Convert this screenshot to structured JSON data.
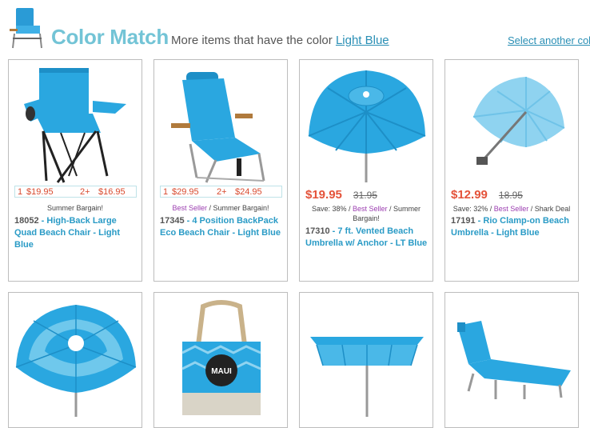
{
  "header": {
    "title": "Color Match",
    "subtitle_prefix": "More items that have the color",
    "color_link": "Light Blue",
    "select_another": "Select another colo"
  },
  "products": [
    {
      "tier_1_qty": "1",
      "tier_1_price": "$19.95",
      "tier_2_qty": "2+",
      "tier_2_price": "$16.95",
      "tagline": "Summer Bargain!",
      "sku": "18052",
      "name": "High-Back Large Quad Beach Chair - Light Blue",
      "icon": "beach-chair"
    },
    {
      "tier_1_qty": "1",
      "tier_1_price": "$29.95",
      "tier_2_qty": "2+",
      "tier_2_price": "$24.95",
      "badge": "Best Seller",
      "tagline_sep": " / ",
      "tagline": "Summer Bargain!",
      "sku": "17345",
      "name": "4 Position BackPack Eco Beach Chair - Light Blue",
      "icon": "backpack-beach-chair"
    },
    {
      "price": "$19.95",
      "old_price": "31.95",
      "save": "Save: 38% / ",
      "badge": "Best Seller",
      "tagline_sep": " / ",
      "tagline": "Summer Bargain!",
      "sku": "17310",
      "name": "7 ft. Vented Beach Umbrella w/ Anchor - LT Blue",
      "icon": "vented-umbrella"
    },
    {
      "price": "$12.99",
      "old_price": "18.95",
      "save": "Save: 32% / ",
      "badge": "Best Seller",
      "tagline_sep": " / ",
      "tagline": "Shark Deal",
      "sku": "17191",
      "name": "Rio Clamp-on Beach Umbrella - Light Blue",
      "icon": "clamp-umbrella"
    },
    {
      "icon": "striped-umbrella"
    },
    {
      "icon": "maui-tote-bag",
      "bag_text": "MAUI"
    },
    {
      "icon": "square-umbrella"
    },
    {
      "icon": "chaise-lounge"
    }
  ],
  "colors": {
    "accent": "#73c4d6",
    "link": "#2a9bc6",
    "price": "#e4533a",
    "best_seller": "#9b3db0",
    "product_blue": "#29a6de"
  }
}
